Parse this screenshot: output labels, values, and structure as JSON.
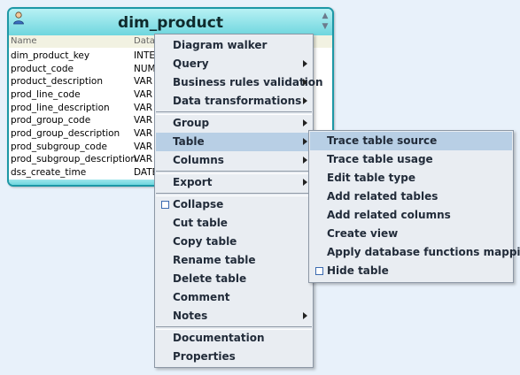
{
  "table": {
    "title": "dim_product",
    "col_name_header": "Name",
    "col_type_header": "Data",
    "rows": [
      {
        "name": "dim_product_key",
        "type": "INTEG"
      },
      {
        "name": "product_code",
        "type": "NUME"
      },
      {
        "name": "product_description",
        "type": "VAR"
      },
      {
        "name": "prod_line_code",
        "type": "VAR"
      },
      {
        "name": "prod_line_description",
        "type": "VAR"
      },
      {
        "name": "prod_group_code",
        "type": "VAR"
      },
      {
        "name": "prod_group_description",
        "type": "VAR"
      },
      {
        "name": "prod_subgroup_code",
        "type": "VAR"
      },
      {
        "name": "prod_subgroup_description",
        "type": "VAR"
      },
      {
        "name": "dss_create_time",
        "type": "DATE"
      }
    ]
  },
  "context_menu": {
    "items": [
      {
        "label": "Diagram walker"
      },
      {
        "label": "Query"
      },
      {
        "label": "Business rules validation"
      },
      {
        "label": "Data transformations"
      },
      {
        "label": "Group"
      },
      {
        "label": "Table"
      },
      {
        "label": "Columns"
      },
      {
        "label": "Export"
      },
      {
        "label": "Collapse"
      },
      {
        "label": "Cut table"
      },
      {
        "label": "Copy table"
      },
      {
        "label": "Rename table"
      },
      {
        "label": "Delete table"
      },
      {
        "label": "Comment"
      },
      {
        "label": "Notes"
      },
      {
        "label": "Documentation"
      },
      {
        "label": "Properties"
      }
    ]
  },
  "table_submenu": {
    "items": [
      {
        "label": "Trace table source"
      },
      {
        "label": "Trace table usage"
      },
      {
        "label": "Edit table type"
      },
      {
        "label": "Add related tables"
      },
      {
        "label": "Add related columns"
      },
      {
        "label": "Create view"
      },
      {
        "label": "Apply database functions mapping"
      },
      {
        "label": "Hide table"
      }
    ]
  },
  "colors": {
    "highlight": "#b8cfe5",
    "table_border": "#1d98a6",
    "header_gradient_top": "#b7f1f4",
    "header_gradient_bottom": "#6fd6de"
  },
  "icons": {
    "table_icon": "user-icon",
    "collapse_icon": "chevron-up-down-icon"
  }
}
